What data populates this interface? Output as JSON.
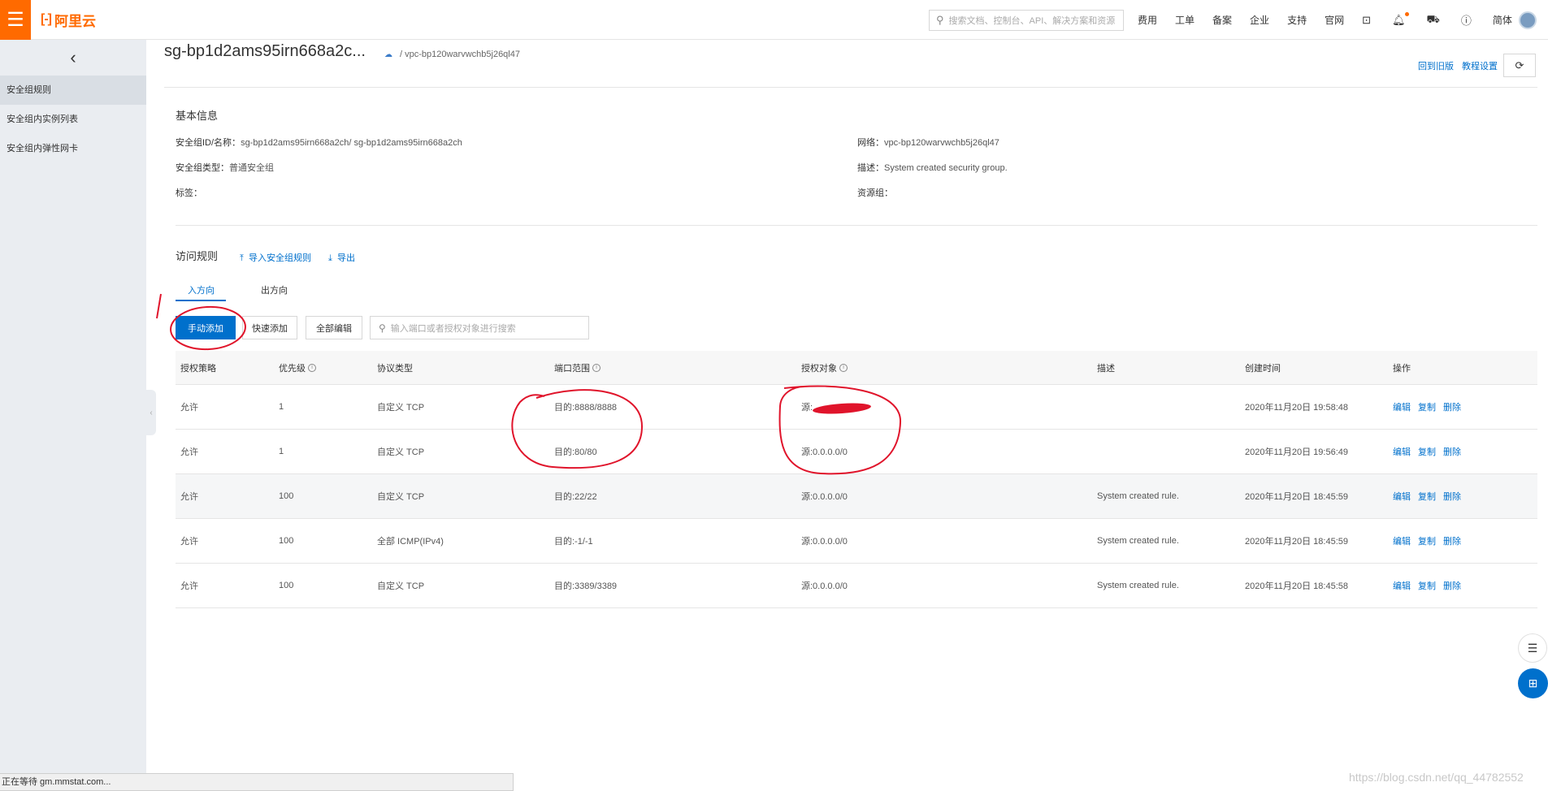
{
  "topbar": {
    "menu_icon": "hamburger-icon",
    "logo_mark": "[-]",
    "logo_text": "阿里云",
    "search_placeholder": "搜索文档、控制台、API、解决方案和资源",
    "nav": [
      "费用",
      "工单",
      "备案",
      "企业",
      "支持",
      "官网"
    ],
    "icons": [
      "terminal-icon",
      "bell-icon",
      "cart-icon",
      "help-icon"
    ],
    "lang": "简体",
    "accent": "#ff6a00"
  },
  "sidebar": {
    "back_icon": "chevron-left-icon",
    "items": [
      {
        "label": "安全组规则",
        "active": true
      },
      {
        "label": "安全组内实例列表",
        "active": false
      },
      {
        "label": "安全组内弹性网卡",
        "active": false
      }
    ]
  },
  "header": {
    "title": "sg-bp1d2ams95irn668a2c...",
    "vpc_crumb": "/ vpc-bp120warvwchb5j26ql47",
    "back_old": "回到旧版",
    "tutorial": "教程设置"
  },
  "basic_info": {
    "title": "基本信息",
    "sg_id_label": "安全组ID/名称：",
    "sg_id_value": "sg-bp1d2ams95irn668a2ch/ sg-bp1d2ams95irn668a2ch",
    "sg_type_label": "安全组类型：",
    "sg_type_value": "普通安全组",
    "tag_label": "标签：",
    "network_label": "网络：",
    "network_value": "vpc-bp120warvwchb5j26ql47",
    "desc_label": "描述：",
    "desc_value": "System created security group.",
    "rg_label": "资源组："
  },
  "rules": {
    "title": "访问规则",
    "import_label": "导入安全组规则",
    "export_label": "导出",
    "tabs": [
      "入方向",
      "出方向"
    ],
    "active_tab": 0,
    "toolbar": {
      "manual_add": "手动添加",
      "quick_add": "快速添加",
      "edit_all": "全部编辑",
      "filter_placeholder": "输入端口或者授权对象进行搜索"
    },
    "columns": [
      "授权策略",
      "优先级",
      "协议类型",
      "端口范围",
      "授权对象",
      "描述",
      "创建时间",
      "操作"
    ],
    "rows": [
      {
        "policy": "允许",
        "priority": "1",
        "protocol": "自定义 TCP",
        "port": "目的:8888/8888",
        "source": "源:",
        "desc": "",
        "time": "2020年11月20日 19:58:48"
      },
      {
        "policy": "允许",
        "priority": "1",
        "protocol": "自定义 TCP",
        "port": "目的:80/80",
        "source": "源:0.0.0.0/0",
        "desc": "",
        "time": "2020年11月20日 19:56:49"
      },
      {
        "policy": "允许",
        "priority": "100",
        "protocol": "自定义 TCP",
        "port": "目的:22/22",
        "source": "源:0.0.0.0/0",
        "desc": "System created rule.",
        "time": "2020年11月20日 18:45:59"
      },
      {
        "policy": "允许",
        "priority": "100",
        "protocol": "全部 ICMP(IPv4)",
        "port": "目的:-1/-1",
        "source": "源:0.0.0.0/0",
        "desc": "System created rule.",
        "time": "2020年11月20日 18:45:59"
      },
      {
        "policy": "允许",
        "priority": "100",
        "protocol": "自定义 TCP",
        "port": "目的:3389/3389",
        "source": "源:0.0.0.0/0",
        "desc": "System created rule.",
        "time": "2020年11月20日 18:45:58"
      }
    ],
    "actions": [
      "编辑",
      "复制",
      "删除"
    ]
  },
  "status_bar": "正在等待 gm.mmstat.com...",
  "watermark": "https://blog.csdn.net/qq_44782552"
}
